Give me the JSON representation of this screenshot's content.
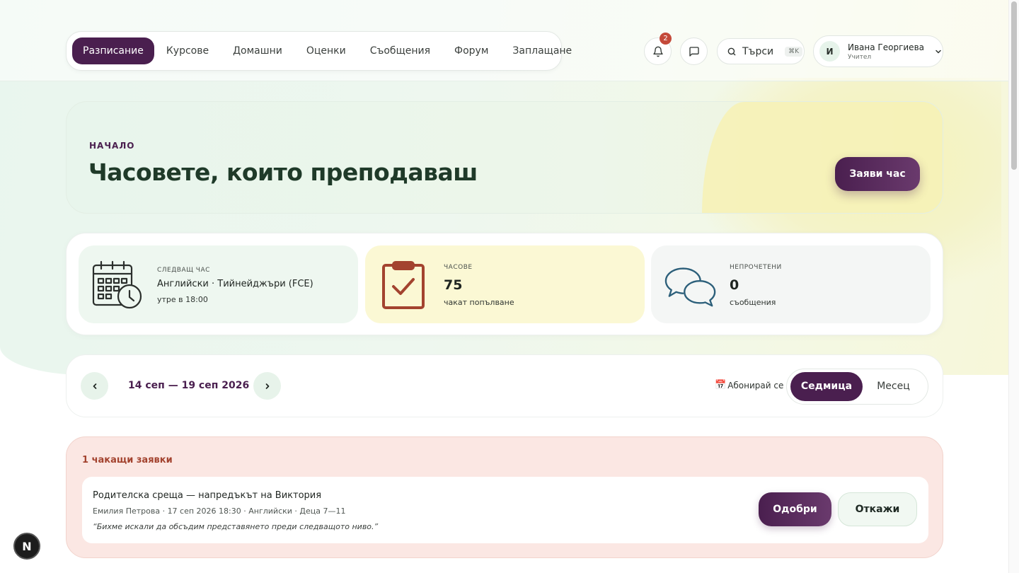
{
  "nav": {
    "items": [
      {
        "label": "Разписание",
        "active": true
      },
      {
        "label": "Курсове"
      },
      {
        "label": "Домашни"
      },
      {
        "label": "Оценки"
      },
      {
        "label": "Съобщения"
      },
      {
        "label": "Форум"
      },
      {
        "label": "Заплащане"
      }
    ]
  },
  "header": {
    "notifications_count": "2",
    "search_label": "Търси",
    "search_shortcut": "⌘K",
    "user": {
      "initial": "И",
      "name": "Ивана Георгиева",
      "role": "Учител"
    }
  },
  "hero": {
    "kicker": "НАЧАЛО",
    "title": "Часовете, които преподаваш",
    "button": "Заяви час"
  },
  "stats": [
    {
      "label": "СЛЕДВАЩ ЧАС",
      "value": "Английски · Тийнейджъри (FCE)",
      "sub": "утре в 18:00",
      "icon": "calendar-clock-icon"
    },
    {
      "label": "ЧАСОВЕ",
      "value": "75",
      "sub": "чакат попълване",
      "icon": "clipboard-check-icon"
    },
    {
      "label": "НЕПРОЧЕТЕНИ",
      "value": "0",
      "sub": "съобщения",
      "icon": "chat-bubbles-icon"
    }
  ],
  "week": {
    "range": "14 сеп — 19 сеп 2026",
    "subscribe": "Абонирай се",
    "calendar_emoji": "📅",
    "views": [
      {
        "label": "Седмица",
        "active": true
      },
      {
        "label": "Месец"
      }
    ]
  },
  "pending": {
    "title": "1 чакащи заявки",
    "request": {
      "title": "Родителска среща — напредъкът на Виктория",
      "meta": "Емилия Петрова · 17 сеп 2026 18:30 · Английски · Деца 7—11",
      "quote": "“Бихме искали да обсъдим представянето преди следващото ниво.”",
      "approve": "Одобри",
      "reject": "Откажи"
    }
  },
  "dev_badge": "N",
  "colors": {
    "primary": "#4a1f4f",
    "accent_green": "#e7f3ea",
    "alert": "#c44a3a",
    "pending_bg": "#fbe7e3"
  }
}
